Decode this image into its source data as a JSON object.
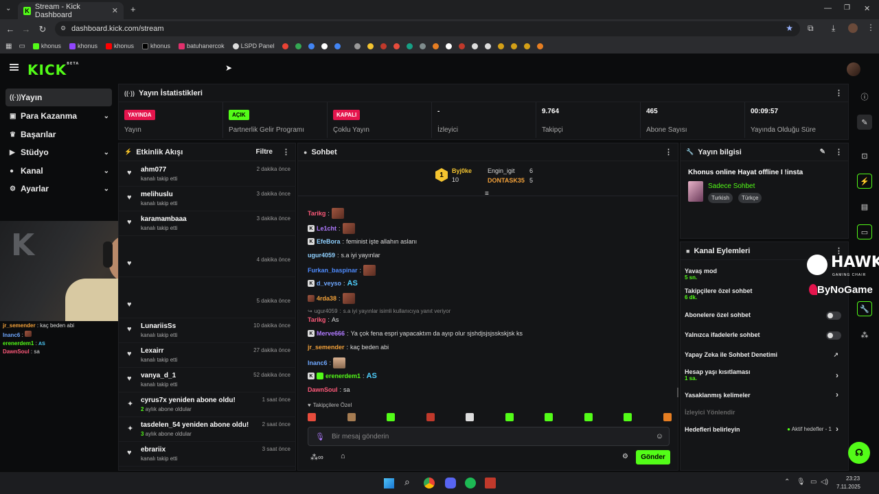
{
  "browser": {
    "tab_title": "Stream - Kick Dashboard",
    "url": "dashboard.kick.com/stream",
    "bookmarks": [
      "khonus",
      "khonus",
      "khonus",
      "khonus",
      "batuhanercok",
      "LSPD Panel"
    ]
  },
  "header": {
    "logo": "KICK",
    "logo_sup": "BETA"
  },
  "sidebar": {
    "items": [
      {
        "label": "Yayın",
        "icon": "broadcast-icon"
      },
      {
        "label": "Para Kazanma",
        "icon": "money-icon"
      },
      {
        "label": "Başarılar",
        "icon": "trophy-icon"
      },
      {
        "label": "Stüdyo",
        "icon": "video-icon"
      },
      {
        "label": "Kanal",
        "icon": "user-icon"
      },
      {
        "label": "Ayarlar",
        "icon": "gear-icon"
      }
    ]
  },
  "stats": {
    "title": "Yayın İstatistikleri",
    "items": [
      {
        "badge": "YAYINDA",
        "label": "Yayın"
      },
      {
        "badge": "AÇIK",
        "label": "Partnerlik Gelir Programı"
      },
      {
        "badge": "KAPALI",
        "label": "Çoklu Yayın"
      },
      {
        "value": "-",
        "label": "İzleyici"
      },
      {
        "value": "9.764",
        "label": "Takipçi"
      },
      {
        "value": "465",
        "label": "Abone Sayısı"
      },
      {
        "value": "00:09:57",
        "label": "Yayında Olduğu Süre"
      }
    ]
  },
  "feed": {
    "title": "Etkinlik Akışı",
    "filter": "Filtre",
    "items": [
      {
        "name": "ahm077",
        "sub": "kanalı takip etti",
        "time": "2 dakika önce"
      },
      {
        "name": "melihuslu",
        "sub": "kanalı takip etti",
        "time": "3 dakika önce"
      },
      {
        "name": "karamambaaa",
        "sub": "kanalı takip etti",
        "time": "3 dakika önce"
      },
      {
        "name": "",
        "sub": "",
        "time": "4 dakika önce"
      },
      {
        "name": "",
        "sub": "",
        "time": "5 dakika önce"
      },
      {
        "name": "LunariisSs",
        "sub": "kanalı takip etti",
        "time": "10 dakika önce"
      },
      {
        "name": "Lexairr",
        "sub": "kanalı takip etti",
        "time": "27 dakika önce"
      },
      {
        "name": "vanya_d_1",
        "sub": "kanalı takip etti",
        "time": "52 dakika önce"
      },
      {
        "name": "cyrus7x yeniden abone oldu!",
        "count": "2",
        "sub": " aylık abone oldular",
        "time": "1 saat önce"
      },
      {
        "name": "tasdelen_54 yeniden abone oldu!",
        "count": "3",
        "sub": " aylık abone oldular",
        "time": "2 saat önce"
      },
      {
        "name": "ebrariix",
        "sub": "kanalı takip etti",
        "time": "3 saat önce"
      }
    ]
  },
  "chat": {
    "title": "Sohbet",
    "leaders": [
      {
        "name": "Byj0ke",
        "count": "10"
      },
      {
        "name": "Engin_igit",
        "count": "6"
      },
      {
        "name": "DONTASK35",
        "count": "5"
      }
    ],
    "messages": [
      {
        "user": "Tarikg",
        "text": ""
      },
      {
        "user": "Le1cht",
        "text": ""
      },
      {
        "user": "EfeBora",
        "text": "feminist işte allahın aslanı"
      },
      {
        "user": "ugur4059",
        "text": "s.a iyi yayınlar"
      },
      {
        "user": "Furkan_baspinar",
        "text": ""
      },
      {
        "user": "d_veyso",
        "text": "AS"
      },
      {
        "user": "4rda38",
        "text": ""
      },
      {
        "user": "ugur4059",
        "text": "s.a iyi yayınlar isimli kullanıcıya yanıt veriyor"
      },
      {
        "user": "Tarikg",
        "text": "As"
      },
      {
        "user": "Merve666",
        "text": "Ya çok fena espri yapacaktım da ayıp olur sjshdjsjsjsskskjsk ks"
      },
      {
        "user": "jr_semender",
        "text": "kaç beden abi"
      },
      {
        "user": "Inanc6",
        "text": ""
      },
      {
        "user": "erenerdem1",
        "text": "AS"
      },
      {
        "user": "DawnSoul",
        "text": "sa"
      }
    ],
    "followers_only": "Takipçilere Özel",
    "input_placeholder": "Bir mesaj gönderin",
    "send": "Gönder"
  },
  "stream_info": {
    "title": "Yayın bilgisi",
    "stream_title": "Khonus online Hayat offline I !insta",
    "category": "Sadece Sohbet",
    "tags": [
      "Turkish",
      "Türkçe"
    ]
  },
  "channel_actions": {
    "title": "Kanal Eylemleri",
    "rows": [
      {
        "label": "Yavaş mod",
        "sub": "5 sn."
      },
      {
        "label": "Takipçilere özel sohbet",
        "sub": "6 dk."
      },
      {
        "label": "Abonelere özel sohbet"
      },
      {
        "label": "Yalnızca ifadelerle sohbet"
      },
      {
        "label": "Yapay Zeka ile Sohbet Denetimi"
      },
      {
        "label": "Hesap yaşı kısıtlaması",
        "sub": "1 sa."
      },
      {
        "label": "Yasaklanmış kelimeler"
      },
      {
        "label": "İzleyici Yönlendir"
      },
      {
        "label": "Hedefleri belirleyin",
        "extra": "Aktif hedefler - 1"
      }
    ]
  },
  "overlay_chat": [
    {
      "user": "jr_semender",
      "text": "kaç beden abi"
    },
    {
      "user": "Inanc6",
      "text": ""
    },
    {
      "user": "erenerdem1",
      "text": "AS"
    },
    {
      "user": "DawnSoul",
      "text": "sa"
    }
  ],
  "sponsor": {
    "hawk": "HAWK",
    "hawk_sub": "GAMING CHAIR",
    "bynogame": "ByNoGame"
  },
  "taskbar": {
    "time": "23:23",
    "date": "7.11.2025"
  }
}
